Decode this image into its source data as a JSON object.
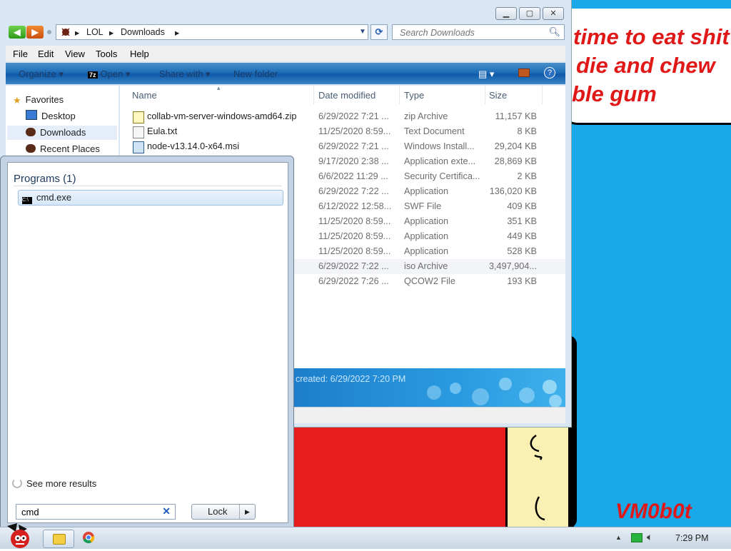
{
  "wallpaper": {
    "bubble_lines": [
      "time to eat shit",
      "die and chew",
      "ble gum"
    ],
    "signature": "VM0b0t"
  },
  "explorer": {
    "breadcrumb": [
      "LOL",
      "Downloads"
    ],
    "search_placeholder": "Search Downloads",
    "menu": [
      "File",
      "Edit",
      "View",
      "Tools",
      "Help"
    ],
    "commands": {
      "organize": "Organize",
      "open": "Open",
      "share": "Share with",
      "new_folder": "New folder"
    },
    "nav_items": [
      "Favorites",
      "Desktop",
      "Downloads",
      "Recent Places"
    ],
    "columns": [
      "Name",
      "Date modified",
      "Type",
      "Size"
    ],
    "files": [
      {
        "name": "collab-vm-server-windows-amd64.zip",
        "date": "6/29/2022 7:21 ...",
        "type": "zip Archive",
        "size": "11,157 KB"
      },
      {
        "name": "Eula.txt",
        "date": "11/25/2020 8:59...",
        "type": "Text Document",
        "size": "8 KB"
      },
      {
        "name": "node-v13.14.0-x64.msi",
        "date": "6/29/2022 7:21 ...",
        "type": "Windows Install...",
        "size": "29,204 KB"
      },
      {
        "name": "",
        "date": "9/17/2020 2:38 ...",
        "type": "Application exte...",
        "size": "28,869 KB"
      },
      {
        "name": "",
        "date": "6/6/2022 11:29 ...",
        "type": "Security Certifica...",
        "size": "2 KB"
      },
      {
        "name": "",
        "date": "6/29/2022 7:22 ...",
        "type": "Application",
        "size": "136,020 KB"
      },
      {
        "name": "",
        "date": "6/12/2022 12:58...",
        "type": "SWF File",
        "size": "409 KB"
      },
      {
        "name": "",
        "date": "11/25/2020 8:59...",
        "type": "Application",
        "size": "351 KB"
      },
      {
        "name": "",
        "date": "11/25/2020 8:59...",
        "type": "Application",
        "size": "449 KB"
      },
      {
        "name": "",
        "date": "11/25/2020 8:59...",
        "type": "Application",
        "size": "528 KB"
      },
      {
        "name": "",
        "date": "6/29/2022 7:22 ...",
        "type": "iso Archive",
        "size": "3,497,904..."
      },
      {
        "name": "",
        "date": "6/29/2022 7:26 ...",
        "type": "QCOW2 File",
        "size": "193 KB"
      }
    ],
    "details_text": "created: 6/29/2022 7:20 PM"
  },
  "start_menu": {
    "programs_header": "Programs (1)",
    "result": "cmd.exe",
    "see_more": "See more results",
    "search_value": "cmd",
    "lock_label": "Lock"
  },
  "taskbar": {
    "clock": "7:29 PM"
  }
}
